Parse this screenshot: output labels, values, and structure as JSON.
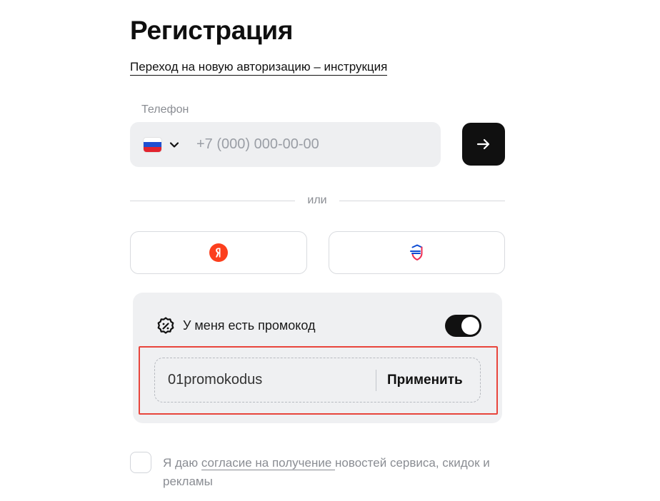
{
  "page": {
    "title": "Регистрация"
  },
  "auth_link": {
    "label": "Переход на новую авторизацию – инструкция"
  },
  "phone": {
    "label": "Телефон",
    "placeholder": "+7 (000) 000-00-00",
    "value": "",
    "country_icon": "russia-flag-icon",
    "dropdown_icon": "chevron-down-icon"
  },
  "submit": {
    "icon": "arrow-right-icon"
  },
  "divider": {
    "text": "или"
  },
  "social": {
    "yandex": {
      "icon": "yandex-logo-icon",
      "color": "#fc3f1d"
    },
    "gosuslugi": {
      "icon": "gosuslugi-logo-icon",
      "colors": [
        "#0d4cd3",
        "#ee2f53"
      ]
    }
  },
  "promo": {
    "icon": "promo-badge-icon",
    "label": "У меня есть промокод",
    "toggle_on": true,
    "code": "01promokodus",
    "apply_label": "Применить"
  },
  "consent": {
    "prefix": "Я даю ",
    "link": "согласие на получение ",
    "suffix": " новостей сервиса, скидок и рекламы",
    "checked": false
  },
  "colors": {
    "accent_dark": "#101010",
    "field_bg": "#eeeff1",
    "muted_text": "#8a8d93",
    "highlight": "#e8453c"
  }
}
